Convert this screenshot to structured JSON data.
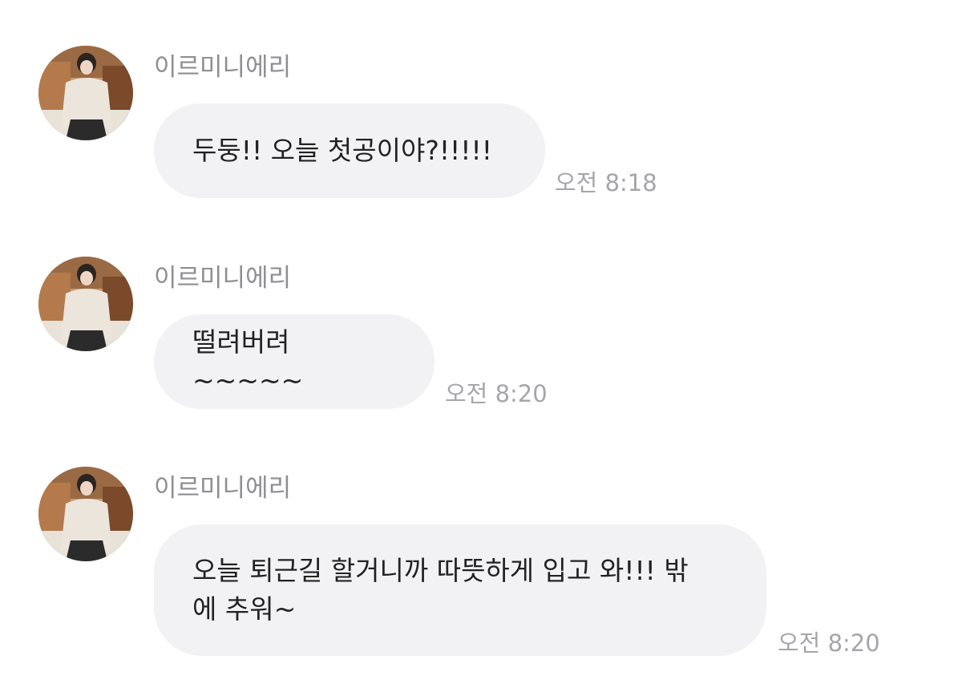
{
  "colors": {
    "background": "#ffffff",
    "bubble": "#f2f2f5",
    "message_text": "#222222",
    "sender_name": "#8e8e93",
    "timestamp": "#a5a5aa"
  },
  "messages": [
    {
      "avatar_icon": "profile-photo",
      "sender": "이르미니에리",
      "text": "두둥!! 오늘 첫공이야?!!!!!",
      "time": "오전 8:18"
    },
    {
      "avatar_icon": "profile-photo",
      "sender": "이르미니에리",
      "text": "떨려버려~~~~~",
      "time": "오전 8:20"
    },
    {
      "avatar_icon": "profile-photo",
      "sender": "이르미니에리",
      "text": "오늘 퇴근길 할거니까 따뜻하게 입고 와!!! 밖\n에 추워~",
      "time": "오전 8:20"
    }
  ]
}
